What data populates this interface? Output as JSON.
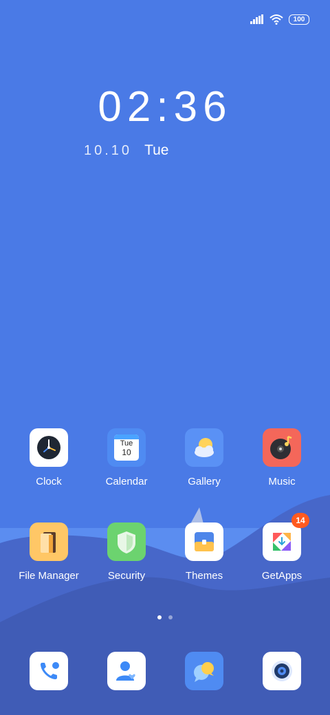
{
  "status_bar": {
    "signal_icon": "signal-icon",
    "wifi_icon": "wifi-icon",
    "battery": "100"
  },
  "lockclock": {
    "time": "02:36",
    "date": "10.10",
    "weekday": "Tue"
  },
  "apps": [
    {
      "label": "Clock",
      "icon": "clock-icon"
    },
    {
      "label": "Calendar",
      "icon": "calendar-icon",
      "day": "Tue",
      "date": "10"
    },
    {
      "label": "Gallery",
      "icon": "gallery-icon"
    },
    {
      "label": "Music",
      "icon": "music-icon"
    },
    {
      "label": "File Manager",
      "icon": "folder-icon"
    },
    {
      "label": "Security",
      "icon": "shield-icon"
    },
    {
      "label": "Themes",
      "icon": "themes-icon"
    },
    {
      "label": "GetApps",
      "icon": "getapps-icon",
      "badge": "14"
    }
  ],
  "dock": [
    {
      "name": "phone",
      "icon": "phone-icon"
    },
    {
      "name": "contacts",
      "icon": "contacts-icon"
    },
    {
      "name": "messages",
      "icon": "messages-icon"
    },
    {
      "name": "camera",
      "icon": "camera-icon"
    }
  ],
  "page_indicator": {
    "pages": 2,
    "active": 1
  },
  "colors": {
    "wallpaper": "#4a7ae6",
    "badge": "#ff5a1f"
  }
}
